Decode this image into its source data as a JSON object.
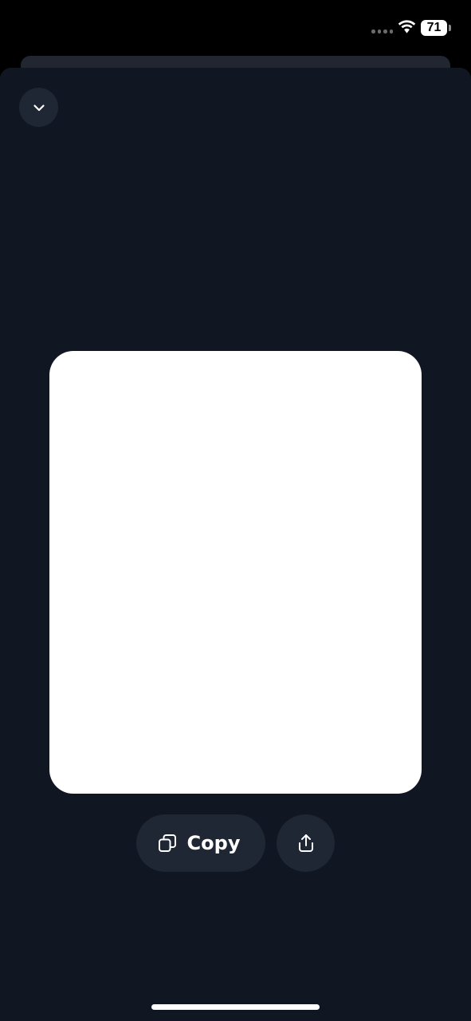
{
  "status_bar": {
    "battery_level": "71",
    "icons": [
      "signal-dots-icon",
      "wifi-icon",
      "battery-icon"
    ]
  },
  "header": {
    "collapse_icon": "chevron-down-icon"
  },
  "actions": {
    "copy_label": "Copy",
    "copy_icon": "copy-icon",
    "share_icon": "share-icon"
  },
  "colors": {
    "background": "#111722",
    "button_background": "#1f2634",
    "card": "#ffffff",
    "text": "#ffffff"
  }
}
